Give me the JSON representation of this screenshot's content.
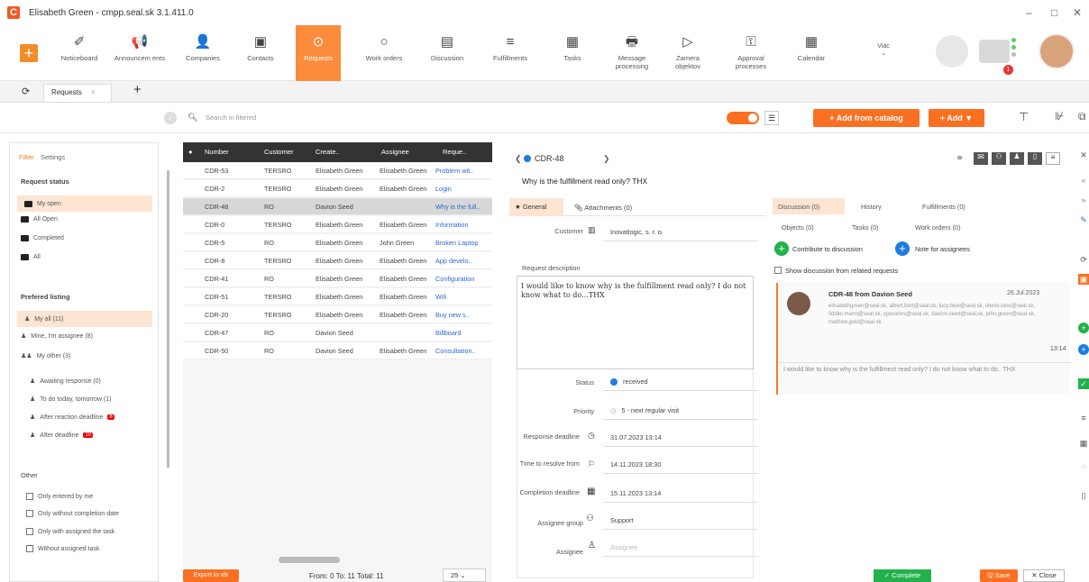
{
  "window": {
    "title": "Elisabeth Green - cmpp.seal.sk 3.1.411.0",
    "minimize": "–",
    "maximize": "□",
    "close": "✕"
  },
  "toolbar": {
    "items": [
      {
        "label": "Noticeboard",
        "icon": "✐"
      },
      {
        "label": "Announcem ents",
        "icon": "📢"
      },
      {
        "label": "Companies",
        "icon": "👤"
      },
      {
        "label": "Contacts",
        "icon": "▣"
      },
      {
        "label": "Requests",
        "icon": "⊙"
      },
      {
        "label": "Work orders",
        "icon": "○"
      },
      {
        "label": "Discussion",
        "icon": "▤"
      },
      {
        "label": "Fulfillments",
        "icon": "≡"
      },
      {
        "label": "Tasks",
        "icon": "▦"
      },
      {
        "label": "Message processing",
        "icon": "🖶"
      },
      {
        "label": "Zamera objektov",
        "icon": "▷"
      },
      {
        "label": "Approval processes",
        "icon": "⚿"
      },
      {
        "label": "Calendar",
        "icon": "▦"
      }
    ],
    "viac": "Viac",
    "viac_arrow": "⌄",
    "notification_count": "1"
  },
  "tabs": {
    "refresh_icon": "⟳",
    "active": "Requests",
    "close": "×",
    "add": "+"
  },
  "search": {
    "placeholder": "Search in filtered",
    "add_from_catalog": "+ Add from catalog",
    "add": "+ Add ▼"
  },
  "filter": {
    "tabs": [
      "Filter",
      "Settings"
    ],
    "request_status_title": "Request status",
    "statuses": [
      "My open",
      "All Open",
      "Completed",
      "All"
    ],
    "preferred_title": "Prefered listing",
    "preferred": [
      "My all (11)",
      "Mine, I'm assignee (8)",
      "My other (3)"
    ],
    "sub": [
      "Awaiting response (0)",
      "To do today, tomorrow (1)",
      "After reaction deadline",
      "After deadline"
    ],
    "sub_badges": [
      "8",
      "10"
    ],
    "other_title": "Other",
    "other": [
      "Only entered by me",
      "Only without completion date",
      "Only with assigned the task",
      "Without assigned task"
    ]
  },
  "grid": {
    "columns": [
      "Number",
      "Customer",
      "Create..",
      "Assignee",
      "Reque.."
    ],
    "rows": [
      [
        "CDR-53",
        "TERSRO",
        "Elisabeth Green",
        "Elisabeth Green",
        "Problem wit.."
      ],
      [
        "CDR-2",
        "TERSRO",
        "Elisabeth Green",
        "Elisabeth Green",
        "Login"
      ],
      [
        "CDR-48",
        "RO",
        "Davion Seed",
        "",
        "Why is the full.."
      ],
      [
        "CDR-0",
        "TERSRO",
        "Elisabeth Green",
        "Elisabeth Green",
        "Information"
      ],
      [
        "CDR-5",
        "RO",
        "Elisabeth Green",
        "John Green",
        "Broken Laptop"
      ],
      [
        "CDR-8",
        "TERSRO",
        "Elisabeth Green",
        "Elisabeth Green",
        "App develo.."
      ],
      [
        "CDR-41",
        "RO",
        "Elisabeth Green",
        "Elisabeth Green",
        "Configuration"
      ],
      [
        "CDR-51",
        "TERSRO",
        "Elisabeth Green",
        "Elisabeth Green",
        "Wifi"
      ],
      [
        "CDR-20",
        "TERSRO",
        "Elisabeth Green",
        "Elisabeth Green",
        "Buy new s.."
      ],
      [
        "CDR-47",
        "RO",
        "Davion Seed",
        "",
        "Billboard"
      ],
      [
        "CDR-50",
        "RO",
        "Davion Seed",
        "Elisabeth Green",
        "Consultation.."
      ]
    ],
    "selected_index": 2,
    "export": "Export to xls",
    "pager": "From: 0  To: 11  Total: 11",
    "page_size": "25"
  },
  "detail": {
    "id": "CDR-48",
    "title": "Why is the fulfillment read only? THX",
    "tabs": [
      "General",
      "Attachments (0)"
    ],
    "customer_label": "Customer",
    "customer": "Inovatlogic, s. r. o.",
    "desc_label": "Request description",
    "description": "I would like to know why is the fulfillment read only? I do not know what to do...THX",
    "status_label": "Status",
    "status": "received",
    "priority_label": "Priority",
    "priority": "5 - next regular visit",
    "response_label": "Response deadline",
    "response": "31.07.2023 13:14",
    "resolve_label": "Time to resolve from",
    "resolve": "14.11.2023 18:30",
    "completion_label": "Completion deadline",
    "completion": "15.11.2023 13:14",
    "group_label": "Assignee group",
    "group": "Support",
    "assignee_label": "Assignee",
    "assignee_placeholder": "Assignee"
  },
  "right": {
    "tabs": [
      "Discussion (0)",
      "History",
      "Fulfillments (0)",
      "Objects (0)",
      "Tasks (0)",
      "Work orders (0)"
    ],
    "contribute": "Contribute to discussion",
    "note": "Note for assignees",
    "show_related": "Show discussion from related requests",
    "msg_title": "CDR-48 from Davion Seed",
    "msg_date": "26.Jul.2023",
    "msg_emails": "elisabethgreen@seal.sk, albert.bert@seal.sk, lucy.blue@seal.sk, olenis.lone@seal.sk, fiddler.mann@seal.sk, operators@seal.sk, davion.seed@seal.sk, john.green@seal.sk, mathew.gold@seal.sk",
    "msg_time": "13:14",
    "msg_text": "I would like to know why is the fulfillment read only? I do not know what to do.. THX",
    "complete": "Complete",
    "save": "Save",
    "close": "Close"
  }
}
